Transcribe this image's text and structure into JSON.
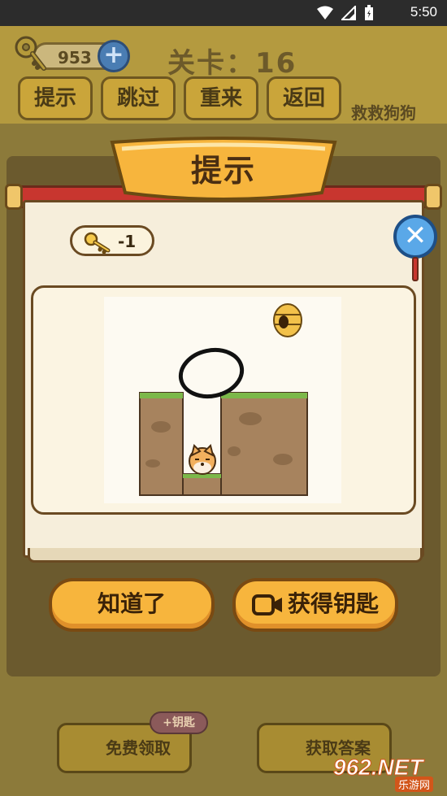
{
  "status_bar": {
    "time": "5:50"
  },
  "hud": {
    "key_count": "953",
    "plus_label": "+",
    "level_title": "关卡：16",
    "buttons": [
      "提示",
      "跳过",
      "重来",
      "返回"
    ],
    "subtitle": "救救狗狗"
  },
  "bottom_bar": {
    "free_claim_label": "免费领取",
    "reward_badge": "+钥匙",
    "get_answer_label": "获取答案"
  },
  "modal": {
    "title": "提示",
    "cost_text": "-1",
    "close_symbol": "✕",
    "ok_button": "知道了",
    "get_key_button": "获得钥匙"
  },
  "watermark": {
    "main": "962.NET",
    "sub": "乐游网"
  },
  "icons": [
    "wifi-icon",
    "signal-icon",
    "battery-icon",
    "key-icon",
    "video-icon",
    "close-icon",
    "beehive-icon",
    "dog-icon"
  ],
  "colors": {
    "accent_orange": "#f7b53d",
    "scroll_red": "#c8362f",
    "close_blue": "#5aa8e8",
    "paper": "#f6eedb"
  }
}
